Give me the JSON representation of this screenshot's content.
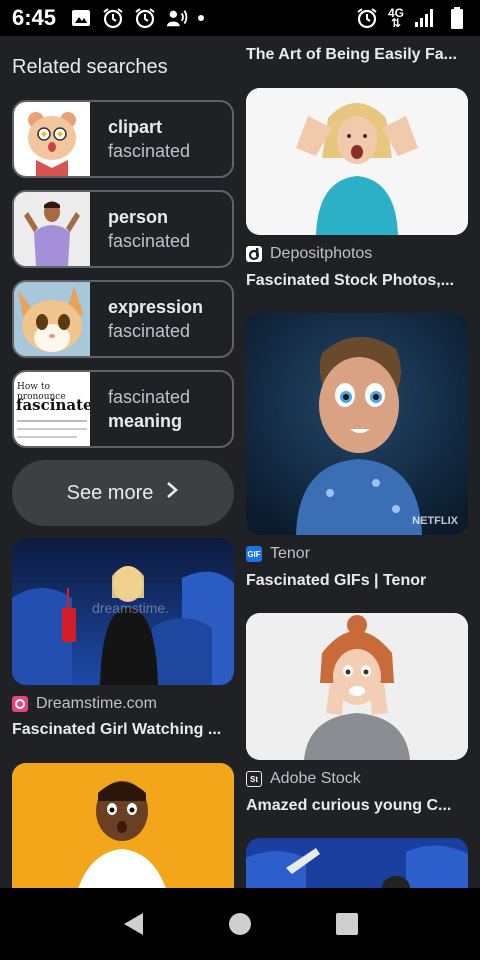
{
  "status_bar": {
    "time": "6:45",
    "network": "4G",
    "icons_left": [
      "image-icon",
      "alarm-icon",
      "alarm-icon",
      "hotspot-icon",
      "dot-icon"
    ],
    "icons_right": [
      "alarm-icon",
      "network-4g-icon",
      "signal-icon",
      "battery-icon"
    ]
  },
  "related": {
    "title": "Related searches",
    "chips": [
      {
        "bold": "clipart",
        "light": "fascinated",
        "bold_first": true
      },
      {
        "bold": "person",
        "light": "fascinated",
        "bold_first": true
      },
      {
        "bold": "expression",
        "light": "fascinated",
        "bold_first": true
      },
      {
        "bold": "meaning",
        "light": "fascinated",
        "bold_first": false,
        "thumb_text_1": "How to pronounce",
        "thumb_text_2": "fascinated"
      }
    ],
    "see_more": "See more"
  },
  "results_left": [
    {
      "source": "Dreamstime.com",
      "title": "Fascinated Girl Watching ...",
      "source_icon": "dreamstime-icon",
      "watermark": "dreamstime."
    }
  ],
  "results_right": [
    {
      "source": "",
      "title": "The Art of Being Easily Fa..."
    },
    {
      "source": "Depositphotos",
      "title": "Fascinated Stock Photos,...",
      "source_icon": "depositphotos-icon"
    },
    {
      "source": "Tenor",
      "title": "Fascinated GIFs | Tenor",
      "source_icon": "tenor-icon",
      "source_icon_text": "GIF",
      "watermark": "NETFLIX"
    },
    {
      "source": "Adobe Stock",
      "title": "Amazed curious young C...",
      "source_icon": "adobe-stock-icon",
      "source_icon_text": "St"
    }
  ],
  "colors": {
    "background": "#202124",
    "chip_border": "#5f6368",
    "see_more_bg": "#3c4043",
    "tenor": "#1a73e8",
    "dreamstime": "#e8457a"
  }
}
